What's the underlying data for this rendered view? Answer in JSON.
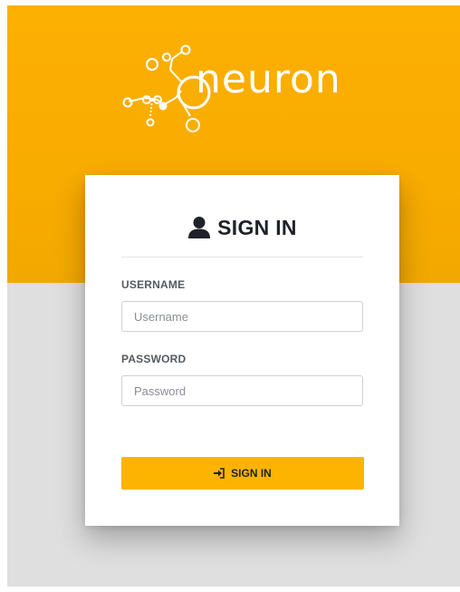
{
  "brand": {
    "name": "neuron",
    "logo_icon": "neuron-network-icon",
    "accent_color": "#fcb002"
  },
  "login": {
    "title": "SIGN IN",
    "title_icon": "user-icon",
    "username": {
      "label": "USERNAME",
      "placeholder": "Username",
      "value": ""
    },
    "password": {
      "label": "PASSWORD",
      "placeholder": "Password",
      "value": ""
    },
    "submit": {
      "label": "SIGN IN",
      "icon": "sign-in-icon"
    }
  }
}
